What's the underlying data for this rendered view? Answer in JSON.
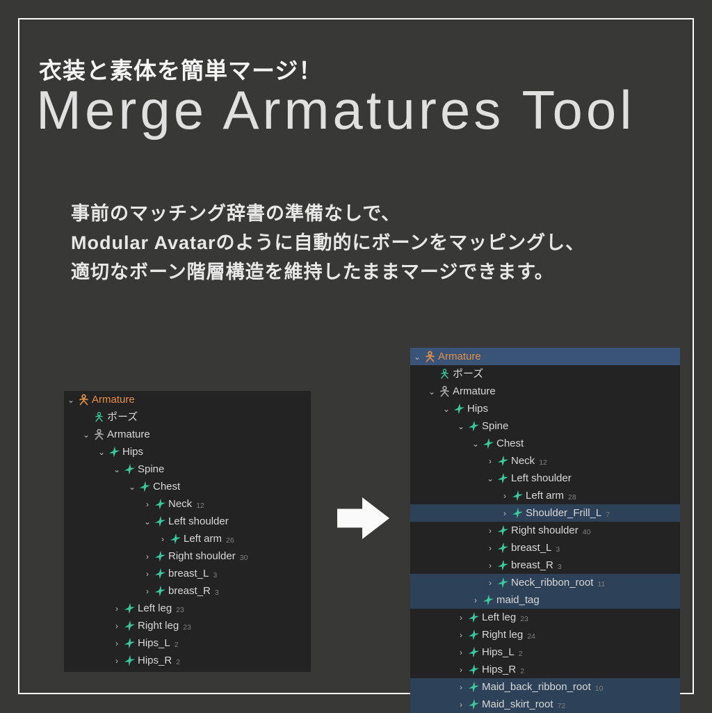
{
  "subtitle": "衣装と素体を簡単マージ！",
  "title": "Merge Armatures Tool",
  "description": "事前のマッチング辞書の準備なしで、\nModular Avatarのように自動的にボーンをマッピングし、\n適切なボーン階層構造を維持したままマージできます。",
  "left_tree": [
    {
      "depth": 0,
      "disc": "open",
      "icon": "arm-o",
      "label": "Armature",
      "orange": true
    },
    {
      "depth": 1,
      "disc": "none",
      "icon": "pose",
      "label": "ポーズ"
    },
    {
      "depth": 1,
      "disc": "open",
      "icon": "arm-g",
      "label": "Armature"
    },
    {
      "depth": 2,
      "disc": "open",
      "icon": "bone",
      "label": "Hips"
    },
    {
      "depth": 3,
      "disc": "open",
      "icon": "bone",
      "label": "Spine"
    },
    {
      "depth": 4,
      "disc": "open",
      "icon": "bone",
      "label": "Chest"
    },
    {
      "depth": 5,
      "disc": "close",
      "icon": "bone",
      "label": "Neck",
      "badge": "12"
    },
    {
      "depth": 5,
      "disc": "open",
      "icon": "bone",
      "label": "Left shoulder"
    },
    {
      "depth": 6,
      "disc": "close",
      "icon": "bone",
      "label": "Left arm",
      "badge": "26"
    },
    {
      "depth": 5,
      "disc": "close",
      "icon": "bone",
      "label": "Right shoulder",
      "badge": "30"
    },
    {
      "depth": 5,
      "disc": "close",
      "icon": "bone",
      "label": "breast_L",
      "badge": "3"
    },
    {
      "depth": 5,
      "disc": "close",
      "icon": "bone",
      "label": "breast_R",
      "badge": "3"
    },
    {
      "depth": 3,
      "disc": "close",
      "icon": "bone",
      "label": "Left leg",
      "badge": "23"
    },
    {
      "depth": 3,
      "disc": "close",
      "icon": "bone",
      "label": "Right leg",
      "badge": "23"
    },
    {
      "depth": 3,
      "disc": "close",
      "icon": "bone",
      "label": "Hips_L",
      "badge": "2"
    },
    {
      "depth": 3,
      "disc": "close",
      "icon": "bone",
      "label": "Hips_R",
      "badge": "2"
    }
  ],
  "right_tree": [
    {
      "depth": 0,
      "disc": "open",
      "icon": "arm-o",
      "label": "Armature",
      "orange": true,
      "hl": true
    },
    {
      "depth": 1,
      "disc": "none",
      "icon": "pose",
      "label": "ポーズ"
    },
    {
      "depth": 1,
      "disc": "open",
      "icon": "arm-g",
      "label": "Armature"
    },
    {
      "depth": 2,
      "disc": "open",
      "icon": "bone",
      "label": "Hips"
    },
    {
      "depth": 3,
      "disc": "open",
      "icon": "bone",
      "label": "Spine"
    },
    {
      "depth": 4,
      "disc": "open",
      "icon": "bone",
      "label": "Chest"
    },
    {
      "depth": 5,
      "disc": "close",
      "icon": "bone",
      "label": "Neck",
      "badge": "12"
    },
    {
      "depth": 5,
      "disc": "open",
      "icon": "bone",
      "label": "Left shoulder"
    },
    {
      "depth": 6,
      "disc": "close",
      "icon": "bone",
      "label": "Left arm",
      "badge": "28"
    },
    {
      "depth": 6,
      "disc": "close",
      "icon": "bone",
      "label": "Shoulder_Frill_L",
      "badge": "7",
      "sel": true
    },
    {
      "depth": 5,
      "disc": "close",
      "icon": "bone",
      "label": "Right shoulder",
      "badge": "40"
    },
    {
      "depth": 5,
      "disc": "close",
      "icon": "bone",
      "label": "breast_L",
      "badge": "3"
    },
    {
      "depth": 5,
      "disc": "close",
      "icon": "bone",
      "label": "breast_R",
      "badge": "3"
    },
    {
      "depth": 5,
      "disc": "close",
      "icon": "bone",
      "label": "Neck_ribbon_root",
      "badge": "11",
      "sel": true
    },
    {
      "depth": 4,
      "disc": "close",
      "icon": "bone",
      "label": "maid_tag",
      "sel": true
    },
    {
      "depth": 3,
      "disc": "close",
      "icon": "bone",
      "label": "Left leg",
      "badge": "23"
    },
    {
      "depth": 3,
      "disc": "close",
      "icon": "bone",
      "label": "Right leg",
      "badge": "24"
    },
    {
      "depth": 3,
      "disc": "close",
      "icon": "bone",
      "label": "Hips_L",
      "badge": "2"
    },
    {
      "depth": 3,
      "disc": "close",
      "icon": "bone",
      "label": "Hips_R",
      "badge": "2"
    },
    {
      "depth": 3,
      "disc": "close",
      "icon": "bone",
      "label": "Maid_back_ribbon_root",
      "badge": "10",
      "sel": true
    },
    {
      "depth": 3,
      "disc": "close",
      "icon": "bone",
      "label": "Maid_skirt_root",
      "badge": "72",
      "sel": true
    }
  ],
  "chart_data": null
}
